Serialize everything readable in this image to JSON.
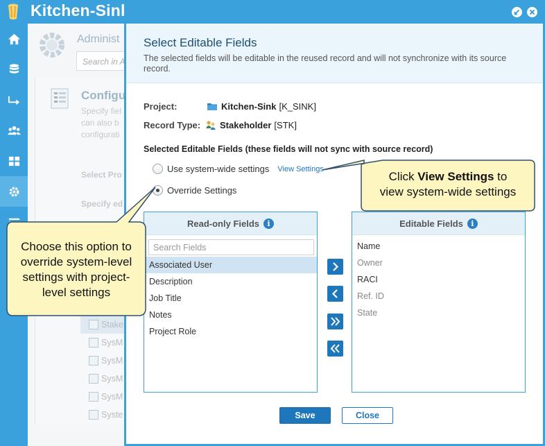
{
  "app": {
    "title": "Kitchen-Sink",
    "nav_icons": [
      "home-icon",
      "database-icon",
      "arrow-right-icon",
      "users-icon",
      "grid-icon",
      "gear-icon",
      "menu-icon"
    ],
    "accent": "#3aa1dc"
  },
  "background": {
    "admin_title": "Administ",
    "search_placeholder": "Search in A",
    "config_title": "Configu",
    "desc_lines": [
      "Specify fiel",
      "can also b",
      "configurati"
    ],
    "label_project": "Select Pro",
    "label_specify": "Specify ed",
    "list": [
      "Stakeh",
      "SysM",
      "SysM",
      "SysM",
      "SysM",
      "Syste"
    ]
  },
  "modal": {
    "title": "Select Editable Fields",
    "description": "The selected fields will be editable in the reused record and will not synchronize with its source record.",
    "project_label": "Project:",
    "project_name": "Kitchen-Sink",
    "project_key": "[K_SINK]",
    "record_type_label": "Record Type:",
    "record_type_name": "Stakeholder",
    "record_type_key": "[STK]",
    "section_title": "Selected Editable Fields (these fields will not sync with source record)",
    "radio_system": "Use system-wide settings",
    "view_settings": "View Settings",
    "radio_override": "Override Settings",
    "readonly": {
      "title": "Read-only Fields",
      "search_placeholder": "Search Fields",
      "items": [
        "Associated User",
        "Description",
        "Job Title",
        "Notes",
        "Project Role"
      ]
    },
    "editable": {
      "title": "Editable Fields",
      "items": [
        "Name",
        "Owner",
        "RACI",
        "Ref. ID",
        "State"
      ]
    },
    "save_label": "Save",
    "close_label": "Close"
  },
  "callouts": {
    "view_settings_pre": "Click ",
    "view_settings_bold": "View Settings",
    "view_settings_post": " to",
    "view_settings_line2": "view system-wide settings",
    "override_lines": [
      "Choose this option to",
      "override system-level",
      "settings with project-",
      "level settings"
    ]
  }
}
